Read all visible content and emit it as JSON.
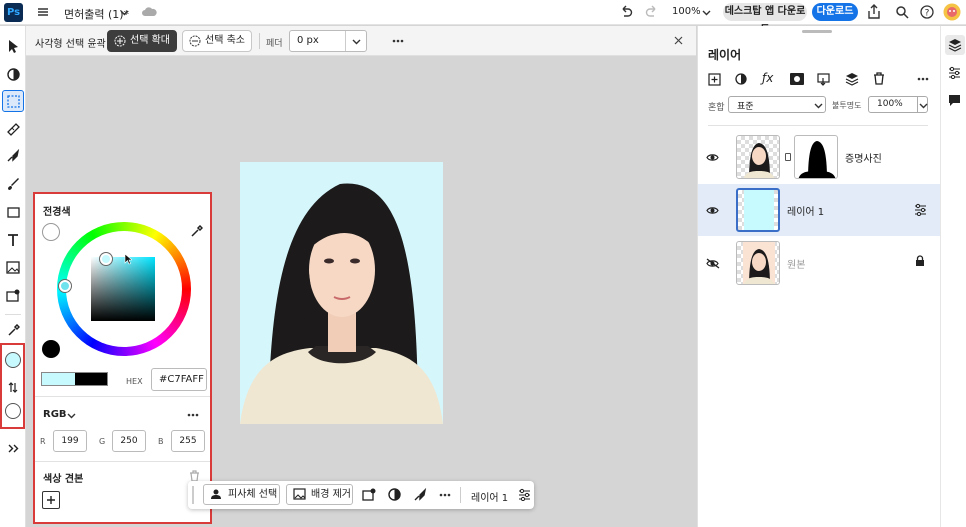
{
  "app": {
    "logo": "Ps",
    "doc_title": "면허출력 (1)*",
    "zoom": "100%",
    "desktop_download": "데스크탑 앱 다운로드",
    "download": "다운로드"
  },
  "options": {
    "tool_name": "사각형 선택 윤곽",
    "expand": "선택 확대",
    "shrink": "선택 축소",
    "feather_label": "페더",
    "feather_value": "0 px"
  },
  "color_panel": {
    "title": "전경색",
    "hex_label": "HEX",
    "hex_value": "#C7FAFF",
    "mode": "RGB",
    "r_label": "R",
    "r": "199",
    "g_label": "G",
    "g": "250",
    "b_label": "B",
    "b": "255",
    "swatches_title": "색상 견본",
    "colors": {
      "foreground": "#C7FAFF",
      "background": "#000000"
    }
  },
  "layers_panel": {
    "title": "레이어",
    "blend_label": "혼합",
    "blend_value": "표준",
    "opacity_label": "불투명도",
    "opacity_value": "100%",
    "layers": [
      {
        "name": "증명사진",
        "visible": true,
        "selected": false
      },
      {
        "name": "레이어 1",
        "visible": true,
        "selected": true
      },
      {
        "name": "원본",
        "visible": false,
        "locked": true
      }
    ]
  },
  "taskbar": {
    "select_subject": "피사체 선택",
    "remove_bg": "배경 제거",
    "layer_name": "레이어 1"
  },
  "accent": "#1473e6",
  "highlight": "#d93a3a"
}
